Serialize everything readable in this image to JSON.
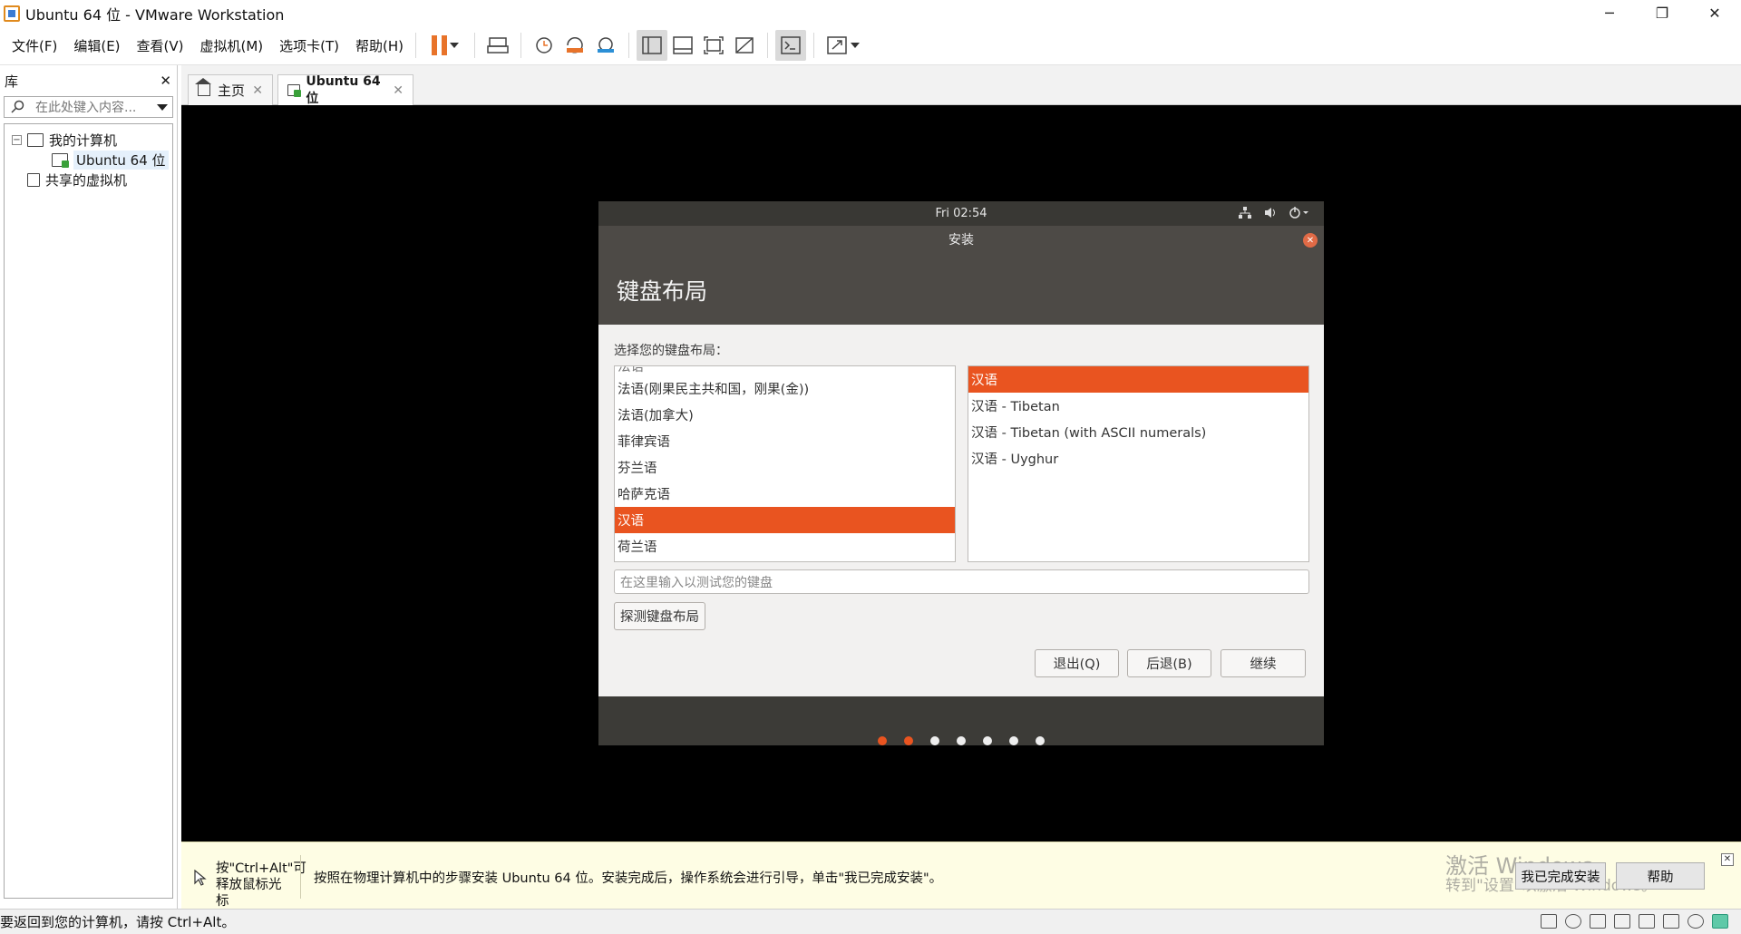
{
  "window": {
    "title": "Ubuntu 64 位 - VMware Workstation",
    "minimize": "─",
    "restore": "❐",
    "close": "✕"
  },
  "menu": [
    "文件(F)",
    "编辑(E)",
    "查看(V)",
    "虚拟机(M)",
    "选项卡(T)",
    "帮助(H)"
  ],
  "library": {
    "title": "库",
    "close": "✕",
    "search_placeholder": "在此处键入内容...",
    "tree": {
      "my_computer": "我的计算机",
      "vm": "Ubuntu 64 位",
      "shared": "共享的虚拟机",
      "toggle": "−"
    }
  },
  "tabs": {
    "home": "主页",
    "vm": "Ubuntu 64 位",
    "close": "✕"
  },
  "guest": {
    "clock": "Fri 02:54",
    "window_title": "安装",
    "heading": "键盘布局",
    "prompt": "选择您的键盘布局：",
    "left_list": [
      "法语",
      "法语(刚果民主共和国，刚果(金))",
      "法语(加拿大)",
      "菲律宾语",
      "芬兰语",
      "哈萨克语",
      "汉语",
      "荷兰语"
    ],
    "left_selected": 6,
    "right_list": [
      "汉语",
      "汉语 - Tibetan",
      "汉语 - Tibetan (with ASCII numerals)",
      "汉语 - Uyghur"
    ],
    "right_selected": 0,
    "test_placeholder": "在这里输入以测试您的键盘",
    "detect_button": "探测键盘布局",
    "quit_button": "退出(Q)",
    "back_button": "后退(B)",
    "continue_button": "继续",
    "progress_total": 7,
    "progress_done": 2,
    "accent": "#e95420"
  },
  "hint": {
    "release": "按\"Ctrl+Alt\"可释放鼠标光标",
    "message": "按照在物理计算机中的步骤安装 Ubuntu 64 位。安装完成后，操作系统会进行引导，单击\"我已完成安装\"。",
    "finish_button": "我已完成安装",
    "help_button": "帮助",
    "close": "✕",
    "watermark_line1": "激活 Windows",
    "watermark_line2": "转到\"设置\"以激活 Windows。"
  },
  "status": {
    "text": "要返回到您的计算机，请按 Ctrl+Alt。"
  }
}
